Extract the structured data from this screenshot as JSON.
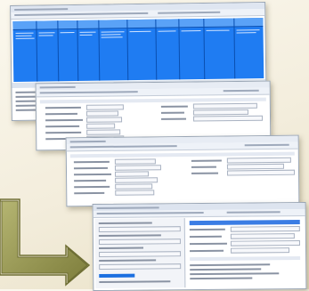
{
  "colors": {
    "background_light": "#fbf8ee",
    "background_dark": "#e9e1c6",
    "grid_blue": "#1f7cf2",
    "arrow_olive": "#8f8f47"
  },
  "icons": [
    "bent-arrow-icon"
  ]
}
